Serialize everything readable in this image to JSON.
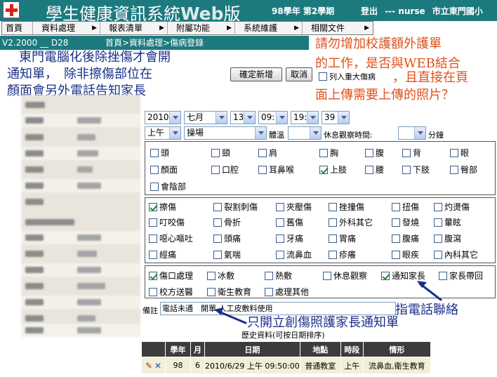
{
  "header": {
    "title_cn": "學生健康資訊系統",
    "title_web": "Web",
    "title_tail": "版",
    "year_sem": "98學年 第2學期",
    "logout": "登出",
    "user": "--- nurse",
    "school": "市立東門國小"
  },
  "menu": {
    "items": [
      {
        "label": "首頁",
        "arrow": ""
      },
      {
        "label": "資料處理",
        "arrow": "▶"
      },
      {
        "label": "報表清單",
        "arrow": "▶"
      },
      {
        "label": "附屬功能",
        "arrow": "▶"
      },
      {
        "label": "系統維護",
        "arrow": "▶"
      },
      {
        "label": "相關文件",
        "arrow": "▶"
      }
    ]
  },
  "subbar": {
    "version": "V2.2000 __ D28",
    "breadcrumb": "首頁>資料處理>傷病登錄"
  },
  "notes": {
    "blue_line1": "東門電腦化後除挫傷才會開",
    "blue_line2": "通知單，　除非擦傷部位在",
    "blue_line3": "顏面會另外電話告知家長",
    "red_line1": "請勿增加校護額外護單",
    "red_line2": "的工作，是否與WEB結合",
    "red_line3": "，且直接在頁",
    "red_line4": "面上傳需要上傳的照片？",
    "phone_note": "指電話聯絡",
    "notice_note": "只開立創傷照護家長通知單"
  },
  "actions": {
    "confirm": "確定新增",
    "cancel": "取消",
    "major_illness": "列入重大傷病"
  },
  "form": {
    "year": "2010",
    "month": "七月",
    "day": "13",
    "hour": "09:",
    "minute": "19:",
    "second": "39",
    "ampm": "上午",
    "place": "操場",
    "body_label": "體溫",
    "body_value": "",
    "rest_label": "休息觀察時間:",
    "rest_value": "",
    "minutes_label": "分鐘"
  },
  "parts": [
    {
      "label": "頭",
      "checked": false
    },
    {
      "label": "頸",
      "checked": false
    },
    {
      "label": "肩",
      "checked": false
    },
    {
      "label": "胸",
      "checked": false
    },
    {
      "label": "腹",
      "checked": false
    },
    {
      "label": "背",
      "checked": false
    },
    {
      "label": "眼",
      "checked": false
    },
    {
      "label": "顏面",
      "checked": false
    },
    {
      "label": "口腔",
      "checked": false
    },
    {
      "label": "耳鼻喉",
      "checked": false
    },
    {
      "label": "上肢",
      "checked": true
    },
    {
      "label": "腰",
      "checked": false
    },
    {
      "label": "下肢",
      "checked": false
    },
    {
      "label": "臀部",
      "checked": false
    },
    {
      "label": "會陰部",
      "checked": false
    }
  ],
  "symptoms": [
    {
      "label": "擦傷",
      "checked": true
    },
    {
      "label": "裂割刺傷",
      "checked": false
    },
    {
      "label": "夾壓傷",
      "checked": false
    },
    {
      "label": "挫撞傷",
      "checked": false
    },
    {
      "label": "扭傷",
      "checked": false
    },
    {
      "label": "灼燙傷",
      "checked": false
    },
    {
      "label": "叮咬傷",
      "checked": false
    },
    {
      "label": "骨折",
      "checked": false
    },
    {
      "label": "舊傷",
      "checked": false
    },
    {
      "label": "外科其它",
      "checked": false
    },
    {
      "label": "發燒",
      "checked": false
    },
    {
      "label": "暈眩",
      "checked": false
    },
    {
      "label": "噁心嘔吐",
      "checked": false
    },
    {
      "label": "頭痛",
      "checked": false
    },
    {
      "label": "牙痛",
      "checked": false
    },
    {
      "label": "胃痛",
      "checked": false
    },
    {
      "label": "腹痛",
      "checked": false
    },
    {
      "label": "腹瀉",
      "checked": false
    },
    {
      "label": "經痛",
      "checked": false
    },
    {
      "label": "氣喘",
      "checked": false
    },
    {
      "label": "流鼻血",
      "checked": false
    },
    {
      "label": "疹癢",
      "checked": false
    },
    {
      "label": "眼疾",
      "checked": false
    },
    {
      "label": "內科其它",
      "checked": false
    }
  ],
  "treatments": [
    {
      "label": "傷口處理",
      "checked": true
    },
    {
      "label": "冰敷",
      "checked": false
    },
    {
      "label": "熱敷",
      "checked": false
    },
    {
      "label": "休息觀察",
      "checked": false
    },
    {
      "label": "通知家長",
      "checked": true
    },
    {
      "label": "家長帶回",
      "checked": false
    },
    {
      "label": "校方送醫",
      "checked": false
    },
    {
      "label": "衛生教育",
      "checked": false
    },
    {
      "label": "處理其他",
      "checked": false
    }
  ],
  "memo": {
    "label": "備註",
    "value": "電話未通　開單 人工皮敷料使用"
  },
  "history": {
    "caption": "歷史資料(可按日期排序)",
    "headers": [
      "",
      "學年",
      "月",
      "日期",
      "地點",
      "時段",
      "情形"
    ],
    "rows": [
      {
        "year": "98",
        "month": "6",
        "date": "2010/6/29 上午 09:50:00",
        "place": "普通教室",
        "period": "上午",
        "status": "流鼻血,衛生教育"
      }
    ]
  }
}
